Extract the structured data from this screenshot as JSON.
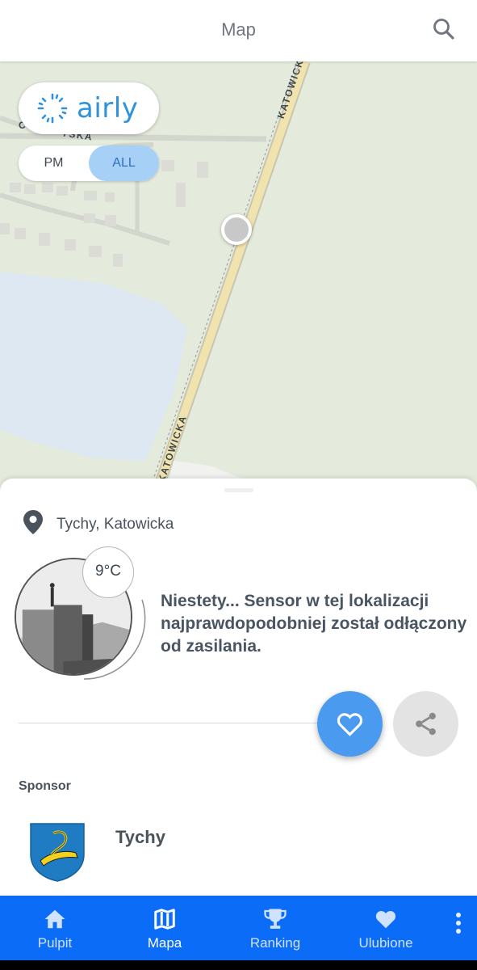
{
  "header": {
    "title": "Map"
  },
  "map": {
    "brand": "airly",
    "toggle": {
      "pm_label": "PM",
      "all_label": "ALL",
      "selected": "ALL"
    },
    "street_labels": [
      "KATOWICKA",
      "KATOWICKA",
      "C",
      "YSKA"
    ]
  },
  "sheet": {
    "location": "Tychy, Katowicka",
    "temperature": "9°C",
    "message": "Niestety... Sensor w tej lokalizacji najprawdopodobniej został odłączony od zasilania.",
    "sponsor_label": "Sponsor",
    "sponsor_name": "Tychy"
  },
  "nav": {
    "items": [
      {
        "label": "Pulpit",
        "icon": "home-icon"
      },
      {
        "label": "Mapa",
        "icon": "map-icon"
      },
      {
        "label": "Ranking",
        "icon": "trophy-icon"
      },
      {
        "label": "Ulubione",
        "icon": "heart-icon"
      }
    ],
    "active": "Mapa"
  },
  "colors": {
    "accent": "#0b6cf7",
    "fav_button": "#4a9bef",
    "brand": "#2e93dc",
    "map_bg": "#e4ebdc",
    "water": "#dde8f2"
  }
}
